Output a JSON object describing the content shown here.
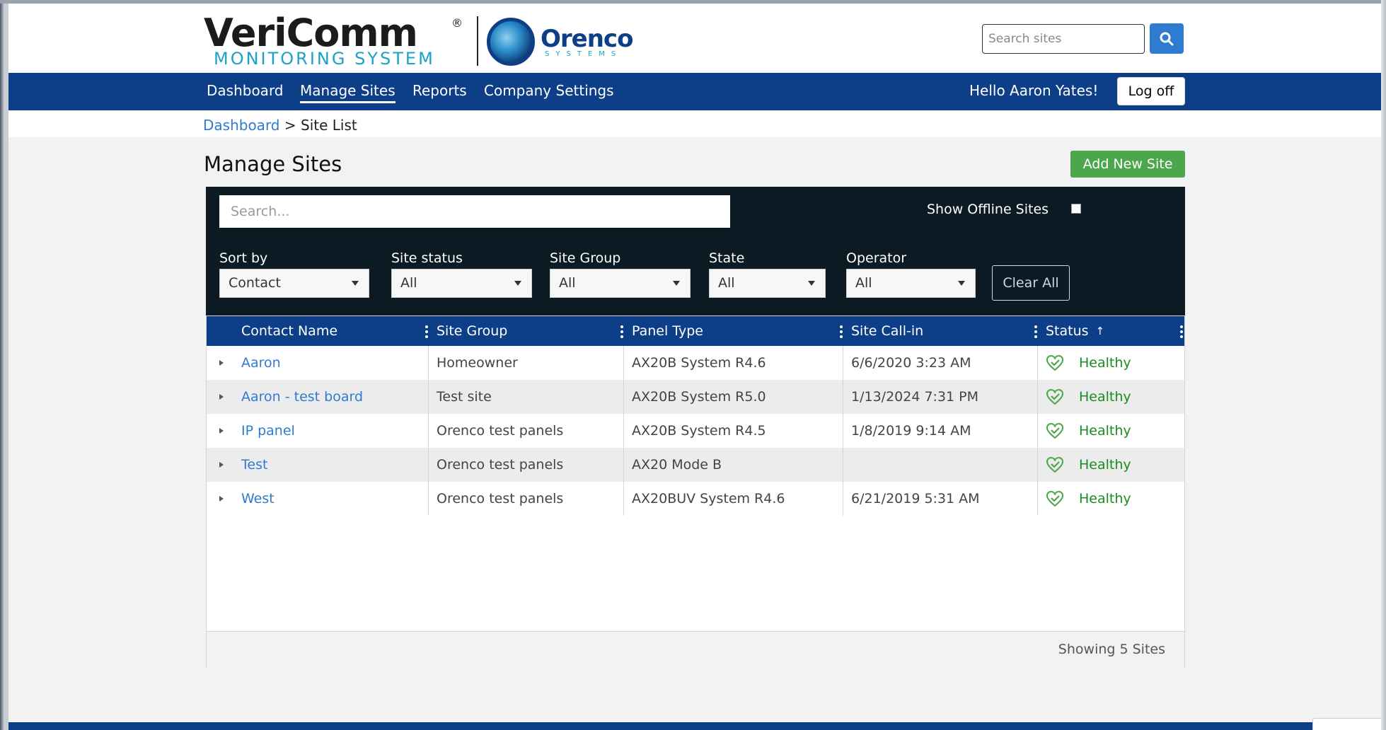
{
  "brand": {
    "vericomm_title": "VeriComm",
    "vericomm_reg": "®",
    "vericomm_subtitle": "MONITORING SYSTEM",
    "orenco_title": "Orenco",
    "orenco_subtitle": "SYSTEMS"
  },
  "header": {
    "search_placeholder": "Search sites",
    "search_icon": "search-icon",
    "accent_color": "#2f7bd1"
  },
  "nav": {
    "items": [
      {
        "label": "Dashboard",
        "active": false
      },
      {
        "label": "Manage Sites",
        "active": true
      },
      {
        "label": "Reports",
        "active": false
      },
      {
        "label": "Company Settings",
        "active": false
      }
    ],
    "greeting": "Hello Aaron Yates!",
    "logoff_label": "Log off",
    "background_color": "#0d3f88"
  },
  "breadcrumb": {
    "link": "Dashboard",
    "separator": ">",
    "current": "Site List"
  },
  "page": {
    "title": "Manage Sites",
    "add_button": "Add New Site",
    "add_button_color": "#4ca64c"
  },
  "filters": {
    "search_placeholder": "Search...",
    "show_offline_label": "Show Offline Sites",
    "show_offline_checked": false,
    "fields": [
      {
        "label": "Sort by",
        "value": "Contact"
      },
      {
        "label": "Site status",
        "value": "All"
      },
      {
        "label": "Site Group",
        "value": "All"
      },
      {
        "label": "State",
        "value": "All"
      },
      {
        "label": "Operator",
        "value": "All"
      }
    ],
    "clear_label": "Clear All"
  },
  "grid": {
    "columns": [
      "Contact Name",
      "Site Group",
      "Panel Type",
      "Site Call-in",
      "Status"
    ],
    "sort_indicator": "↑",
    "rows": [
      {
        "contact": "Aaron",
        "group": "Homeowner",
        "panel": "AX20B System R4.6",
        "callin": "6/6/2020 3:23 AM",
        "status": "Healthy"
      },
      {
        "contact": "Aaron - test board",
        "group": "Test site",
        "panel": "AX20B System R5.0",
        "callin": "1/13/2024 7:31 PM",
        "status": "Healthy"
      },
      {
        "contact": "IP panel",
        "group": "Orenco test panels",
        "panel": "AX20B System R4.5",
        "callin": "1/8/2019 9:14 AM",
        "status": "Healthy"
      },
      {
        "contact": "Test",
        "group": "Orenco test panels",
        "panel": "AX20 Mode B",
        "callin": "",
        "status": "Healthy"
      },
      {
        "contact": "West",
        "group": "Orenco test panels",
        "panel": "AX20BUV System R4.6",
        "callin": "6/21/2019 5:31 AM",
        "status": "Healthy"
      }
    ],
    "status_color": "#1c8c1c",
    "status_icon": "heart-check-icon",
    "footer_text": "Showing 5 Sites"
  }
}
